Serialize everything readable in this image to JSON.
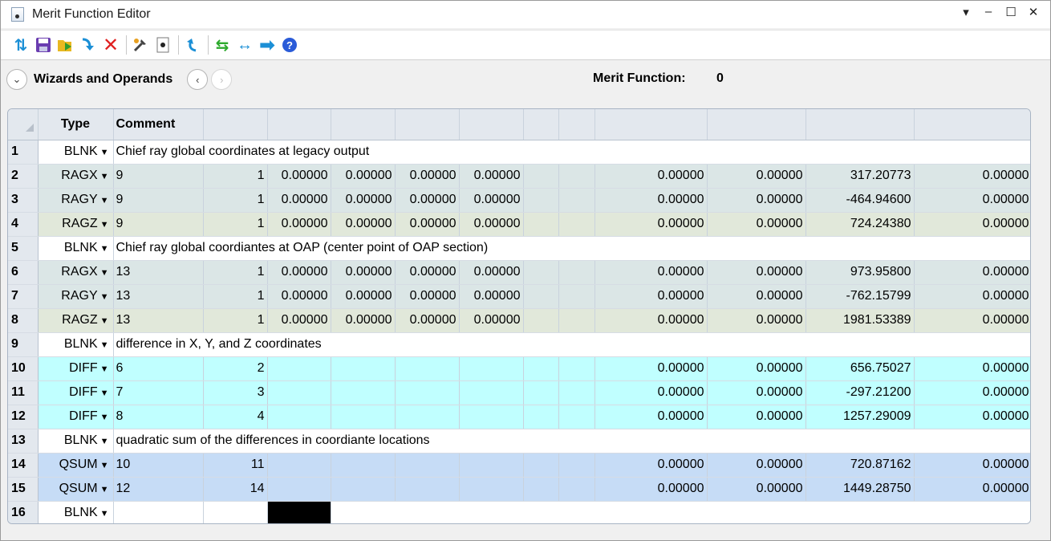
{
  "window": {
    "title": "Merit Function Editor"
  },
  "win_controls": {
    "menu": "▾",
    "minimize": "–",
    "maximize": "☐",
    "close": "✕"
  },
  "wizard_bar": {
    "label": "Wizards and Operands",
    "merit_label": "Merit Function:",
    "merit_value": "0"
  },
  "table": {
    "headers": [
      "",
      "Type",
      "Comment",
      "",
      "",
      "",
      "",
      "",
      "",
      "",
      "",
      "",
      ""
    ],
    "rows": [
      {
        "num": "1",
        "type": "BLNK",
        "comment": "Chief ray global coordinates at legacy output"
      },
      {
        "num": "2",
        "type": "RAGX",
        "comment": "9",
        "c1": "1",
        "p1": "0.00000",
        "p2": "0.00000",
        "p3": "0.00000",
        "p4": "0.00000",
        "target": "0.00000",
        "weight": "0.00000",
        "value": "317.20773",
        "contrib": "0.00000"
      },
      {
        "num": "3",
        "type": "RAGY",
        "comment": "9",
        "c1": "1",
        "p1": "0.00000",
        "p2": "0.00000",
        "p3": "0.00000",
        "p4": "0.00000",
        "target": "0.00000",
        "weight": "0.00000",
        "value": "-464.94600",
        "contrib": "0.00000"
      },
      {
        "num": "4",
        "type": "RAGZ",
        "comment": "9",
        "c1": "1",
        "p1": "0.00000",
        "p2": "0.00000",
        "p3": "0.00000",
        "p4": "0.00000",
        "target": "0.00000",
        "weight": "0.00000",
        "value": "724.24380",
        "contrib": "0.00000"
      },
      {
        "num": "5",
        "type": "BLNK",
        "comment": "Chief ray global coordiantes at OAP (center point of OAP section)"
      },
      {
        "num": "6",
        "type": "RAGX",
        "comment": "13",
        "c1": "1",
        "p1": "0.00000",
        "p2": "0.00000",
        "p3": "0.00000",
        "p4": "0.00000",
        "target": "0.00000",
        "weight": "0.00000",
        "value": "973.95800",
        "contrib": "0.00000"
      },
      {
        "num": "7",
        "type": "RAGY",
        "comment": "13",
        "c1": "1",
        "p1": "0.00000",
        "p2": "0.00000",
        "p3": "0.00000",
        "p4": "0.00000",
        "target": "0.00000",
        "weight": "0.00000",
        "value": "-762.15799",
        "contrib": "0.00000"
      },
      {
        "num": "8",
        "type": "RAGZ",
        "comment": "13",
        "c1": "1",
        "p1": "0.00000",
        "p2": "0.00000",
        "p3": "0.00000",
        "p4": "0.00000",
        "target": "0.00000",
        "weight": "0.00000",
        "value": "1981.53389",
        "contrib": "0.00000"
      },
      {
        "num": "9",
        "type": "BLNK",
        "comment": "difference in X, Y, and Z coordinates"
      },
      {
        "num": "10",
        "type": "DIFF",
        "comment": "6",
        "c1": "2",
        "target": "0.00000",
        "weight": "0.00000",
        "value": "656.75027",
        "contrib": "0.00000"
      },
      {
        "num": "11",
        "type": "DIFF",
        "comment": "7",
        "c1": "3",
        "target": "0.00000",
        "weight": "0.00000",
        "value": "-297.21200",
        "contrib": "0.00000"
      },
      {
        "num": "12",
        "type": "DIFF",
        "comment": "8",
        "c1": "4",
        "target": "0.00000",
        "weight": "0.00000",
        "value": "1257.29009",
        "contrib": "0.00000"
      },
      {
        "num": "13",
        "type": "BLNK",
        "comment": "quadratic sum of the differences in coordiante locations"
      },
      {
        "num": "14",
        "type": "QSUM",
        "comment": "10",
        "c1": "11",
        "target": "0.00000",
        "weight": "0.00000",
        "value": "720.87162",
        "contrib": "0.00000"
      },
      {
        "num": "15",
        "type": "QSUM",
        "comment": "12",
        "c1": "14",
        "target": "0.00000",
        "weight": "0.00000",
        "value": "1449.28750",
        "contrib": "0.00000"
      },
      {
        "num": "16",
        "type": "BLNK",
        "comment": ""
      }
    ]
  },
  "icons": {
    "refresh": "refresh-icon",
    "save": "save-icon",
    "load": "load-icon",
    "insert": "insert-icon",
    "delete": "delete-icon",
    "tools": "tools-icon",
    "settings": "settings-icon",
    "undo": "undo-icon",
    "sync": "sync-icon",
    "expand": "expand-icon",
    "forward": "forward-icon",
    "help": "help-icon"
  },
  "colors": {
    "rag_row": "#dbe6e6",
    "ragz_row": "#e1e8da",
    "diff_row": "#c0ffff",
    "qsum_row": "#c6dcf6",
    "header": "#e3e8ee"
  }
}
